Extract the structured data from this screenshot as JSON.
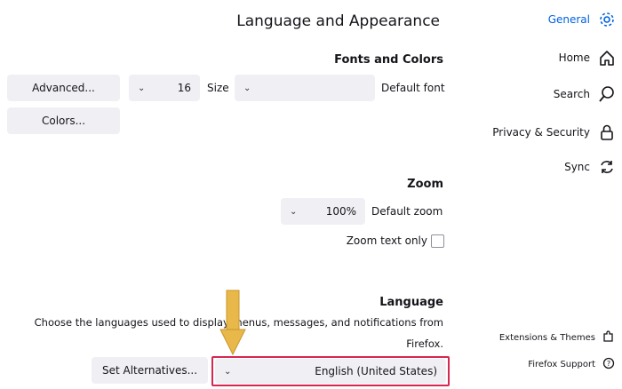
{
  "page": {
    "title": "Language and Appearance"
  },
  "fonts": {
    "heading": "Fonts and Colors",
    "default_font_label": "Default font",
    "default_font_value": "",
    "size_label": "Size",
    "size_value": "16",
    "advanced_button": "Advanced...",
    "colors_button": "Colors..."
  },
  "zoom": {
    "heading": "Zoom",
    "default_zoom_label": "Default zoom",
    "default_zoom_value": "100%",
    "zoom_text_only_label": "Zoom text only"
  },
  "language": {
    "heading": "Language",
    "desc_line1": "Choose the languages used to display menus, messages, and notifications from",
    "desc_line2": "Firefox.",
    "selected_language": "English (United States)",
    "set_alternatives_button": "Set Alternatives..."
  },
  "sidebar": {
    "items": [
      {
        "label": "General",
        "icon": "gear-icon",
        "active": true
      },
      {
        "label": "Home",
        "icon": "home-icon"
      },
      {
        "label": "Search",
        "icon": "search-icon"
      },
      {
        "label": "Privacy & Security",
        "icon": "lock-icon"
      },
      {
        "label": "Sync",
        "icon": "sync-icon"
      }
    ],
    "footer": [
      {
        "label": "Extensions & Themes",
        "icon": "puzzle-icon"
      },
      {
        "label": "Firefox Support",
        "icon": "help-icon"
      }
    ]
  },
  "colors": {
    "accent": "#0061e0",
    "highlight_border": "#d7264f",
    "arrow": "#e8b84a"
  }
}
